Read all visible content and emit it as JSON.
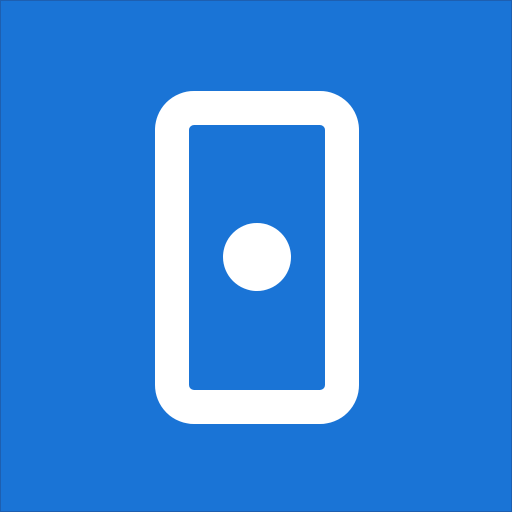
{
  "app_icon": {
    "icon_name": "door-icon",
    "background_color": "#1a74d6",
    "foreground_color": "#ffffff"
  }
}
